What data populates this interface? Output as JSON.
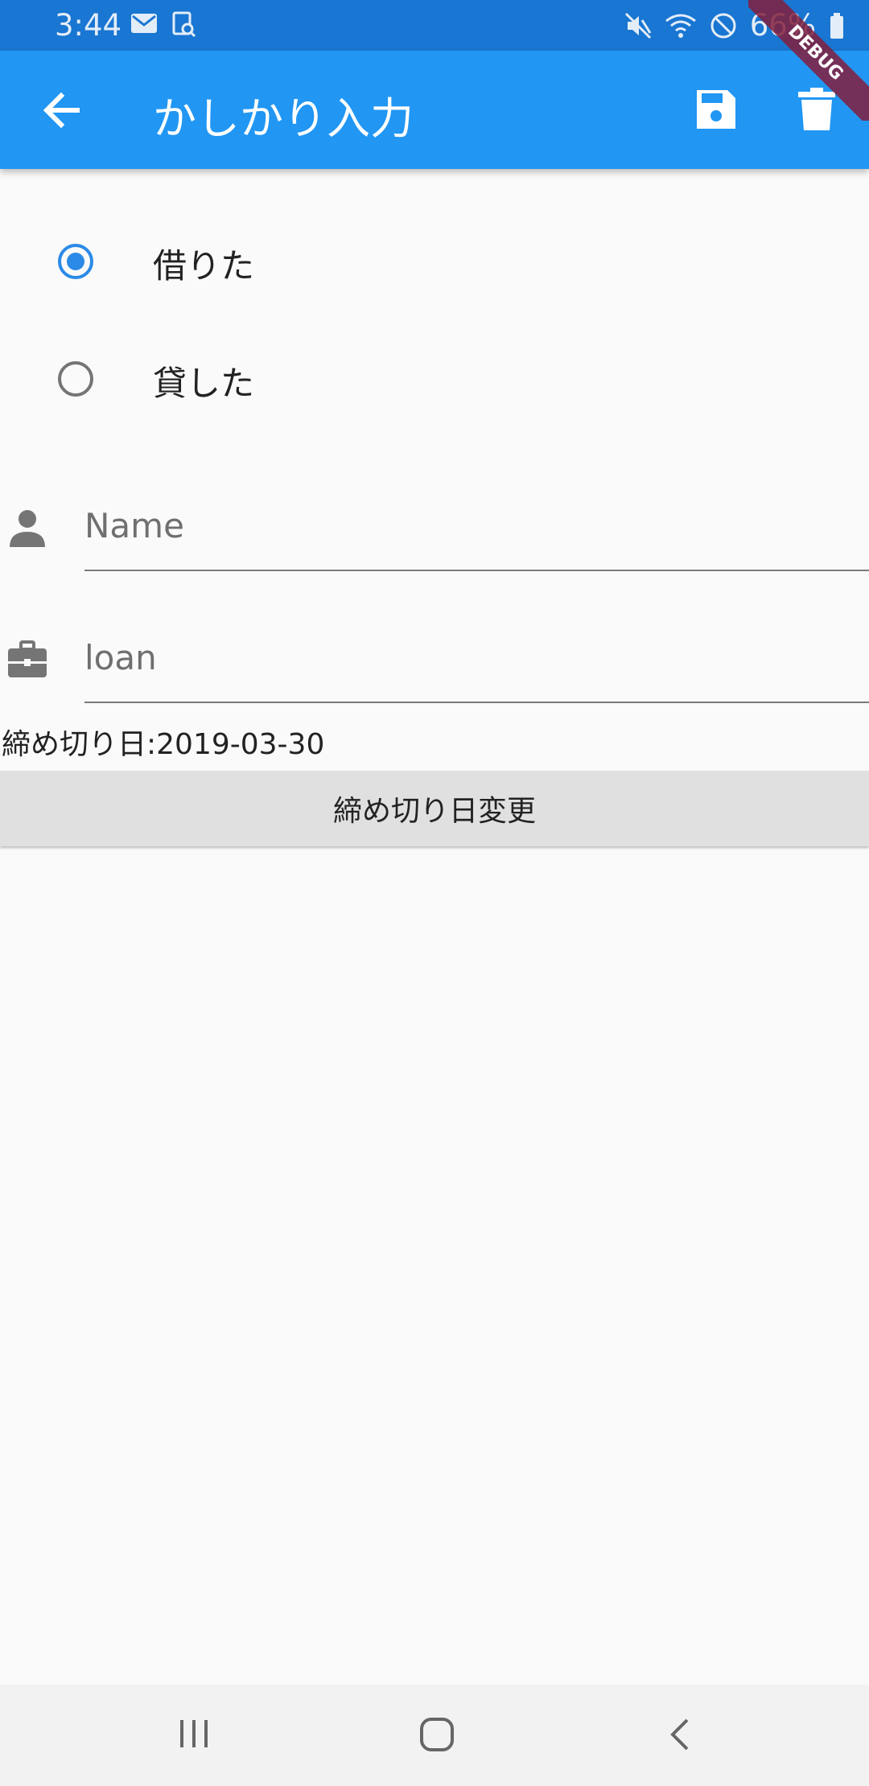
{
  "status_bar": {
    "time": "3:44",
    "battery": "66%",
    "left_icons": [
      "mail-icon",
      "screenshot-icon"
    ],
    "right_icons": [
      "mute-icon",
      "wifi-icon",
      "blocked-icon"
    ]
  },
  "app_bar": {
    "title": "かしかり入力",
    "icons": [
      "back-arrow-icon",
      "save-icon",
      "delete-icon"
    ],
    "color": "#2196f3"
  },
  "debug_banner": "DEBUG",
  "radio_options": [
    {
      "label": "借りた",
      "selected": true
    },
    {
      "label": "貸した",
      "selected": false
    }
  ],
  "fields": {
    "name": {
      "placeholder": "Name",
      "icon": "person-icon"
    },
    "loan": {
      "placeholder": "loan",
      "icon": "briefcase-icon"
    }
  },
  "deadline": {
    "text": "締め切り日:2019-03-30",
    "button_label": "締め切り日変更"
  },
  "nav_bar": {
    "icons": [
      "recent-apps-icon",
      "home-icon",
      "back-icon"
    ]
  }
}
